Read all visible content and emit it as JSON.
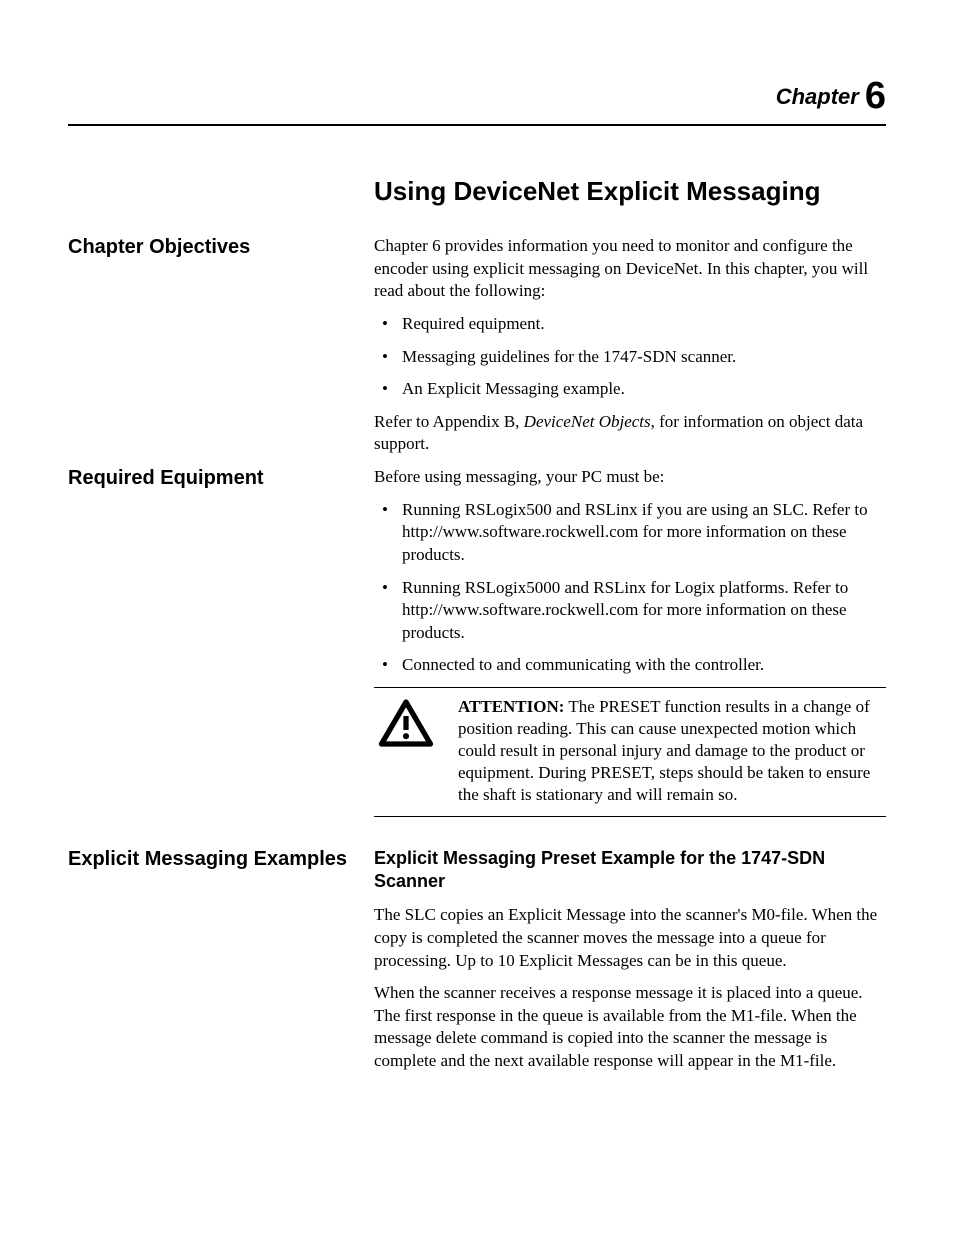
{
  "chapter": {
    "label": "Chapter",
    "number": "6"
  },
  "title": "Using DeviceNet Explicit Messaging",
  "sections": {
    "objectives": {
      "heading": "Chapter Objectives",
      "intro": "Chapter 6 provides information you need to monitor and configure the encoder using explicit messaging on DeviceNet. In this chapter, you will read about the following:",
      "items": [
        "Required equipment.",
        "Messaging guidelines for the 1747-SDN scanner.",
        "An Explicit Messaging example."
      ],
      "refer_pre": "Refer to Appendix B, ",
      "refer_em": "DeviceNet Objects",
      "refer_post": ", for information on object data support."
    },
    "equipment": {
      "heading": "Required Equipment",
      "intro": "Before using messaging, your PC must be:",
      "items": [
        "Running RSLogix500 and RSLinx if you are using an SLC. Refer to http://www.software.rockwell.com for more information on these products.",
        "Running RSLogix5000 and RSLinx for Logix platforms. Refer to http://www.software.rockwell.com for more information on these products.",
        "Connected to and communicating with the controller."
      ],
      "attention": {
        "label": "ATTENTION:",
        "text": "The PRESET function results in a change of position reading.  This can cause unexpected motion which could result in personal injury and damage to the product or equipment. During PRESET, steps should be taken to ensure the shaft is stationary and will remain so."
      }
    },
    "examples": {
      "heading": "Explicit Messaging Examples",
      "subheading": "Explicit Messaging Preset Example for the 1747-SDN Scanner",
      "p1": "The SLC copies an Explicit Message into the scanner's M0-file. When the copy is completed the scanner moves the message into a queue for processing. Up to 10 Explicit Messages can be in this queue.",
      "p2": "When the scanner receives a response message it is placed into a queue. The first response in the queue is available from the M1-file. When the message delete command is copied into the scanner the message is complete and the next available response will appear in the M1-file."
    }
  }
}
